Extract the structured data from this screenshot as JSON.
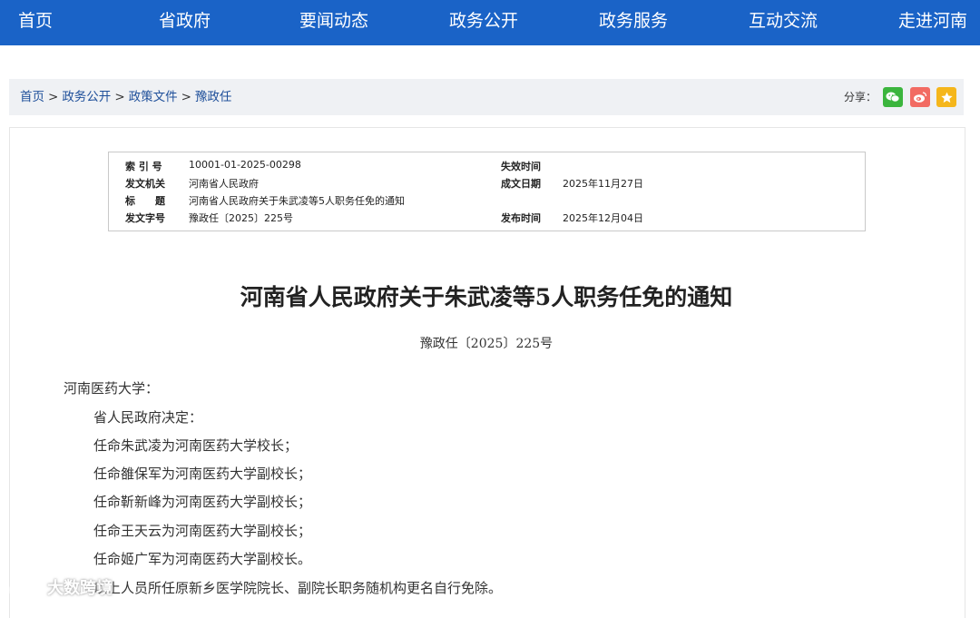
{
  "nav": {
    "items": [
      "首页",
      "省政府",
      "要闻动态",
      "政务公开",
      "政务服务",
      "互动交流",
      "走进河南"
    ]
  },
  "breadcrumb": {
    "home": "首页",
    "level1": "政务公开",
    "level2": "政策文件",
    "level3": "豫政任",
    "separator": ">"
  },
  "share": {
    "label": "分享：",
    "buttons": [
      {
        "name": "wechat",
        "icon": "wechat-icon",
        "color": "#3bb53d"
      },
      {
        "name": "weibo",
        "icon": "weibo-icon",
        "color": "#f26b63"
      },
      {
        "name": "favorite",
        "icon": "star-icon",
        "color": "#f5b61b"
      }
    ]
  },
  "meta": {
    "index_label": "索 引 号",
    "index_value": "10001-01-2025-00298",
    "expiry_label": "失效时间",
    "expiry_value": "",
    "issuer_label": "发文机关",
    "issuer_value": "河南省人民政府",
    "date_label": "成文日期",
    "date_value": "2025年11月27日",
    "title_label": "标　　题",
    "title_value": "河南省人民政府关于朱武凌等5人职务任免的通知",
    "docno_label": "发文字号",
    "docno_value": "豫政任〔2025〕225号",
    "publish_label": "发布时间",
    "publish_value": "2025年12月04日"
  },
  "document": {
    "title": "河南省人民政府关于朱武凌等5人职务任免的通知",
    "number": "豫政任〔2025〕225号",
    "salutation": "河南医药大学：",
    "paragraphs": [
      "省人民政府决定：",
      "任命朱武凌为河南医药大学校长；",
      "任命雒保军为河南医药大学副校长；",
      "任命靳新峰为河南医药大学副校长；",
      "任命王天云为河南医药大学副校长；",
      "任命姬广军为河南医药大学副校长。",
      "以上人员所任原新乡医学院院长、副院长职务随机构更名自行免除。"
    ]
  },
  "watermark": {
    "text": "大数跨境"
  }
}
